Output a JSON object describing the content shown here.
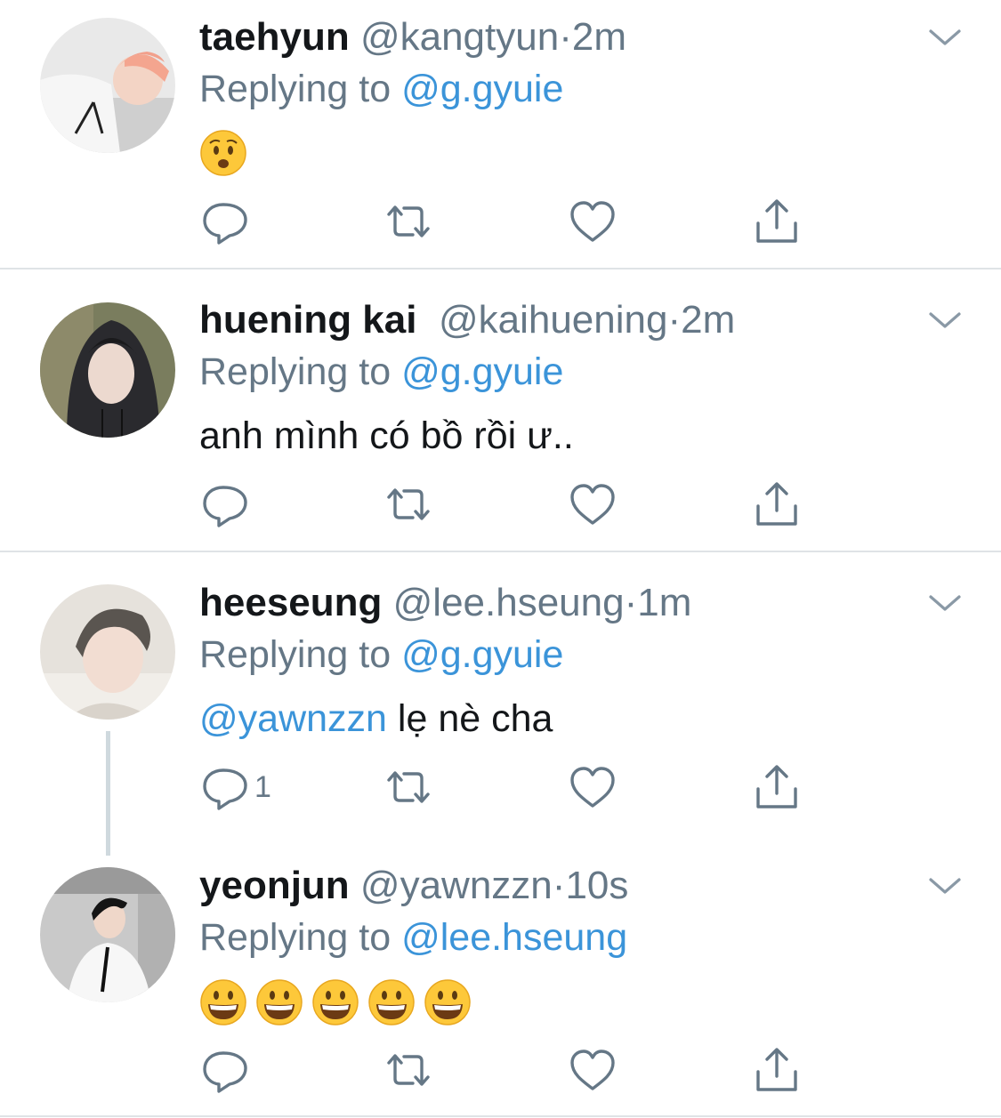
{
  "tweets": [
    {
      "name": "taehyun",
      "handle": "@kangtyun",
      "dot": "·",
      "time": "2m",
      "replying_prefix": "Replying to ",
      "replying_to": "@g.gyuie",
      "emoji": [
        "anguished-face"
      ],
      "actions": {
        "reply_count": "",
        "retweet_count": "",
        "like_count": ""
      }
    },
    {
      "name": "huening kai",
      "handle": "@kaihuening",
      "dot": "·",
      "time": "2m",
      "replying_prefix": "Replying to ",
      "replying_to": "@g.gyuie",
      "text": "anh mình có bồ rồi ư..",
      "actions": {
        "reply_count": "",
        "retweet_count": "",
        "like_count": ""
      }
    },
    {
      "name": "heeseung",
      "handle": "@lee.hseung",
      "dot": "·",
      "time": "1m",
      "replying_prefix": "Replying to ",
      "replying_to": "@g.gyuie",
      "mention": "@yawnzzn",
      "text": " lẹ nè cha",
      "actions": {
        "reply_count": "1",
        "retweet_count": "",
        "like_count": ""
      }
    },
    {
      "name": "yeonjun",
      "handle": "@yawnzzn",
      "dot": "·",
      "time": "10s",
      "replying_prefix": "Replying to ",
      "replying_to": "@lee.hseung",
      "emoji": [
        "grinning-face",
        "grinning-face",
        "grinning-face",
        "grinning-face",
        "grinning-face"
      ],
      "actions": {
        "reply_count": "",
        "retweet_count": "",
        "like_count": ""
      }
    }
  ],
  "icons": {
    "reply": "speech-bubble-icon",
    "retweet": "retweet-arrows-icon",
    "like": "heart-icon",
    "share": "share-upload-icon",
    "menu": "chevron-down-icon"
  },
  "colors": {
    "link": "#3b94d9",
    "secondary_text": "#657786",
    "divider": "#dfe3e6",
    "thread_line": "#cfd9de",
    "icon": "#657786"
  }
}
